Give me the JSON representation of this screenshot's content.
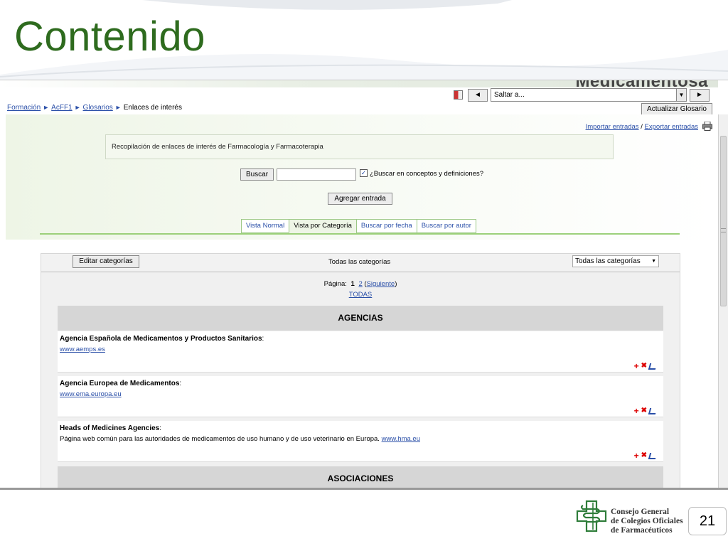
{
  "slide": {
    "title": "Contenido",
    "page_number": "21"
  },
  "brand_text": "Medicamentosa",
  "nav": {
    "prev_label": "◄",
    "next_label": "►",
    "jump_select": "Saltar a...",
    "update_button": "Actualizar Glosario"
  },
  "breadcrumb": {
    "items": [
      "Formación",
      "AcFF1",
      "Glosarios"
    ],
    "current": "Enlaces de interés",
    "separator": "►"
  },
  "io_links": {
    "import": "Importar entradas",
    "export": "Exportar entradas",
    "slash": "/"
  },
  "description": "Recopilación de enlaces de interés de Farmacología y Farmacoterapia",
  "search": {
    "button": "Buscar",
    "value": "",
    "checkbox_label": "¿Buscar en conceptos y definiciones?",
    "checked": true
  },
  "add_entry": "Agregar entrada",
  "tabs": [
    {
      "label": "Vista Normal"
    },
    {
      "label": "Vista por Categoría"
    },
    {
      "label": "Buscar por fecha"
    },
    {
      "label": "Buscar por autor"
    }
  ],
  "panel": {
    "edit_categories": "Editar categorías",
    "all_categories_label": "Todas las categorías",
    "category_select": "Todas las categorías",
    "paging_label": "Página:",
    "current_page": "1",
    "next_page": "2",
    "next_link": "Siguiente",
    "all_link": "TODAS"
  },
  "categories": [
    {
      "name": "AGENCIAS",
      "entries": [
        {
          "title": "Agencia Española de Medicamentos y Productos Sanitarios",
          "line": "",
          "link": "www.aemps.es"
        },
        {
          "title": "Agencia Europea de Medicamentos",
          "line": "",
          "link": "www.ema.europa.eu"
        },
        {
          "title": "Heads of Medicines Agencies",
          "line": "Página web común para las autoridades de medicamentos de uso humano y de uso veterinario en Europa.",
          "link": "www.hma.eu"
        }
      ]
    },
    {
      "name": "ASOCIACIONES",
      "entries": []
    }
  ],
  "logo": {
    "line1": "Consejo General",
    "line2": "de Colegios Oficiales",
    "line3": "de Farmacéuticos"
  },
  "colors": {
    "title_green": "#2e6b1e",
    "link_blue": "#2a4fa8",
    "tab_border": "#9cc885",
    "delete_red": "#d00000"
  }
}
